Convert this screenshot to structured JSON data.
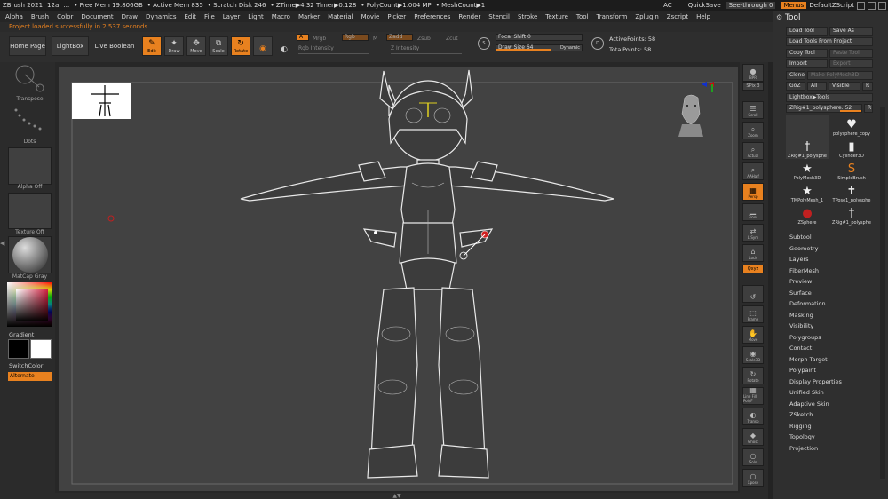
{
  "titlebar": {
    "items": [
      "ZBrush 2021",
      "12a",
      "…",
      "• Free Mem 19.806GB",
      "• Active Mem 835",
      "• Scratch Disk 246",
      "• ZTime▶4.32 Timer▶0.128",
      "• PolyCount▶1.004 MP",
      "• MeshCount▶1"
    ],
    "ac": "AC",
    "quicksave": "QuickSave",
    "see_through": "See-through  0",
    "menus": "Menus",
    "script": "DefaultZScript"
  },
  "menubar": [
    "Alpha",
    "Brush",
    "Color",
    "Document",
    "Draw",
    "Dynamics",
    "Edit",
    "File",
    "Layer",
    "Light",
    "Macro",
    "Marker",
    "Material",
    "Movie",
    "Picker",
    "Preferences",
    "Render",
    "Stencil",
    "Stroke",
    "Texture",
    "Tool",
    "Transform",
    "Zplugin",
    "Zscript",
    "Help"
  ],
  "status": "Project loaded successfully in 2.537 seconds.",
  "shelf": {
    "home": "Home Page",
    "lightbox": "LightBox",
    "live_boolean": "Live Boolean",
    "modes": [
      {
        "label": "Edit",
        "icon": "edit-icon",
        "glyph": "✎",
        "on": true
      },
      {
        "label": "Draw",
        "icon": "draw-icon",
        "glyph": "✦",
        "on": false
      },
      {
        "label": "Move",
        "icon": "move-icon",
        "glyph": "✥",
        "on": false
      },
      {
        "label": "Scale",
        "icon": "scale-icon",
        "glyph": "⧉",
        "on": false
      },
      {
        "label": "Rotate",
        "icon": "rotate-icon",
        "glyph": "↻",
        "on": true
      }
    ],
    "a_btn": "A",
    "mrgb": "Mrgb",
    "rgb": "Rgb",
    "m": "M",
    "zadd": "Zadd",
    "zsub": "Zsub",
    "zcut": "Zcut",
    "rgb_intensity": "Rgb Intensity",
    "z_intensity": "Z Intensity",
    "focal_shift": "Focal Shift",
    "focal_shift_val": "0",
    "draw_size": "Draw Size",
    "draw_size_val": "64",
    "dynamic": "Dynamic",
    "active_points": "ActivePoints: 58",
    "total_points": "TotalPoints: 58"
  },
  "leftpanel": {
    "transpose": "Transpose",
    "dots": "Dots",
    "alpha": "Alpha Off",
    "texture": "Texture Off",
    "material": "MatCap Gray",
    "gradient": "Gradient",
    "switchcolor": "SwitchColor",
    "alternate": "Alternate"
  },
  "rightstrip": [
    {
      "label": "BPR",
      "icon": "bpr-icon",
      "glyph": "●"
    },
    {
      "label": "SPix 3",
      "icon": "spix-icon",
      "glyph": ""
    },
    {
      "label": "Scroll",
      "icon": "scroll-icon",
      "glyph": "☰"
    },
    {
      "label": "Zoom",
      "icon": "zoom-icon",
      "glyph": "⌕"
    },
    {
      "label": "Actual",
      "icon": "actual-icon",
      "glyph": "⌕"
    },
    {
      "label": "AAHalf",
      "icon": "aahalf-icon",
      "glyph": "⌕"
    },
    {
      "label": "Persp",
      "icon": "persp-icon",
      "glyph": "▦"
    },
    {
      "label": "Floor",
      "icon": "floor-icon",
      "glyph": "▁"
    },
    {
      "label": "L.Sym",
      "icon": "lsym-icon",
      "glyph": "⇄"
    },
    {
      "label": "Lock",
      "icon": "lock-icon",
      "glyph": "⌂"
    },
    {
      "label": "Qxyz",
      "icon": "qxyz-icon",
      "glyph": ""
    },
    {
      "label": "",
      "icon": "rotate-axis-icon",
      "glyph": "↺"
    },
    {
      "label": "Frame",
      "icon": "frame-icon",
      "glyph": "⬚"
    },
    {
      "label": "Move",
      "icon": "move-view-icon",
      "glyph": "✋"
    },
    {
      "label": "Scale3D",
      "icon": "scale3d-icon",
      "glyph": "◉"
    },
    {
      "label": "Rotate",
      "icon": "rotate-view-icon",
      "glyph": "↻"
    },
    {
      "label": "Line Fill PolyF",
      "icon": "polyframe-icon",
      "glyph": "▦"
    },
    {
      "label": "Transp",
      "icon": "transp-icon",
      "glyph": "◐"
    },
    {
      "label": "Ghost",
      "icon": "ghost-icon",
      "glyph": "◆"
    },
    {
      "label": "Solo",
      "icon": "solo-icon",
      "glyph": "○"
    },
    {
      "label": "Xpose",
      "icon": "xpose-icon",
      "glyph": "○"
    }
  ],
  "toolpanel": {
    "title": "Tool",
    "load_tool": "Load Tool",
    "save_as": "Save As",
    "load_project": "Load Tools From Project",
    "copy_tool": "Copy Tool",
    "paste_tool": "Paste Tool",
    "import": "Import",
    "export": "Export",
    "clone": "Clone",
    "make_polymesh": "Make PolyMesh3D",
    "goz": "GoZ",
    "all": "All",
    "visible": "Visible",
    "r": "R",
    "lightbox_tools": "Lightbox▶Tools",
    "current_tool": "ZRig#1_polysphere. 52",
    "tools": [
      {
        "name": "ZRig#1_polysphe",
        "glyph": "†"
      },
      {
        "name": "polysphere_copy",
        "glyph": "♥"
      },
      {
        "name": "",
        "glyph": ""
      },
      {
        "name": "Cylinder3D",
        "glyph": "▮"
      },
      {
        "name": "PolyMesh3D",
        "glyph": "★"
      },
      {
        "name": "SimpleBrush",
        "glyph": "S"
      },
      {
        "name": "TMPolyMesh_1",
        "glyph": "★"
      },
      {
        "name": "TPose1_polysphe",
        "glyph": "✝"
      },
      {
        "name": "ZSphere",
        "glyph": "●"
      },
      {
        "name": "ZRig#1_polysphe",
        "glyph": "†"
      }
    ],
    "subpalettes": [
      "Subtool",
      "Geometry",
      "Layers",
      "FiberMesh",
      "Preview",
      "Surface",
      "Deformation",
      "Masking",
      "Visibility",
      "Polygroups",
      "Contact",
      "Morph Target",
      "Polypaint",
      "Display Properties",
      "Unified Skin",
      "Adaptive Skin",
      "ZSketch",
      "Rigging",
      "Topology",
      "Projection"
    ]
  },
  "colors": {
    "accent": "#e8811f",
    "panel": "#2f2f2f",
    "canvas": "#424242"
  }
}
